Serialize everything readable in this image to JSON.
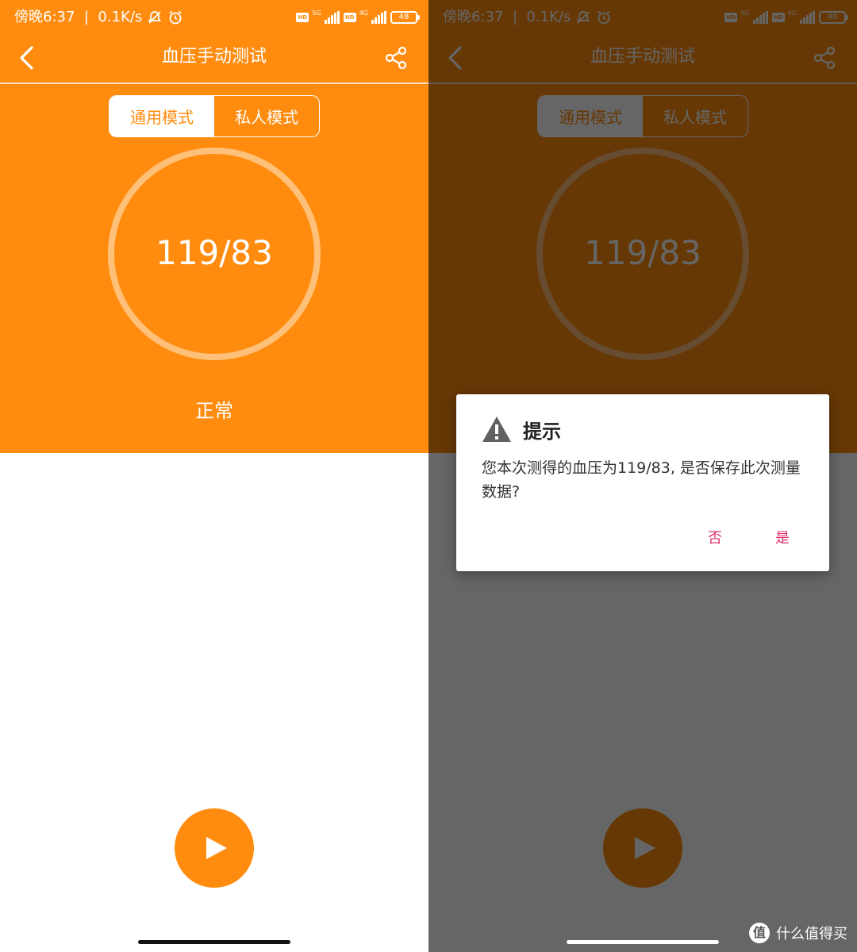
{
  "status_bar": {
    "time": "傍晚6:37",
    "net_speed": "0.1K/s",
    "hd_badge": "HD",
    "net_5g": "5G",
    "net_4g": "4G",
    "battery": "48"
  },
  "header": {
    "title": "血压手动测试"
  },
  "mode_toggle": {
    "general": "通用模式",
    "private": "私人模式",
    "selected": "general"
  },
  "measurement": {
    "reading": "119/83",
    "status": "正常"
  },
  "dialog": {
    "title": "提示",
    "message": "您本次测得的血压为119/83, 是否保存此次测量数据?",
    "no_label": "否",
    "yes_label": "是"
  },
  "watermark": {
    "logo": "值",
    "text": "什么值得买"
  },
  "colors": {
    "accent": "#FF8C0E",
    "ring": "#FFC07A",
    "dialog_button": "#E0306B"
  },
  "icons": {
    "back": "chevron-left-icon",
    "share": "share-icon",
    "play": "play-icon",
    "warning": "warning-icon",
    "mute": "bell-muted-icon",
    "alarm": "alarm-icon",
    "signal": "signal-icon"
  }
}
